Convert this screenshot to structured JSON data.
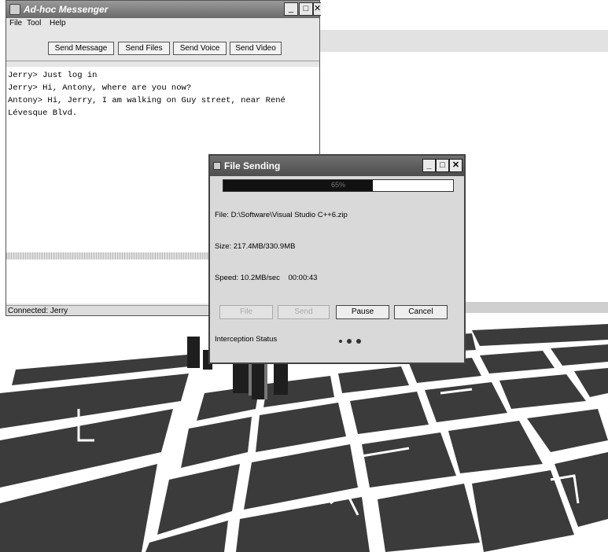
{
  "messenger": {
    "title": "Ad-hoc Messenger",
    "menu": [
      "File",
      "Tool",
      "Help"
    ],
    "toolbar": {
      "send_message": "Send Message",
      "send_files": "Send Files",
      "send_voice": "Send Voice",
      "send_video": "Send Video"
    },
    "chat_lines": [
      "Jerry> Just log in",
      "Jerry> Hi, Antony, where are you now?",
      "Antony> Hi, Jerry, I am walking on Guy street, near René",
      "Lévesque Blvd."
    ],
    "status": "Connected: Jerry"
  },
  "dialog": {
    "title": "File Sending",
    "progress_percent": 65,
    "progress_label": "65%",
    "file": "File: D:\\Software\\Visual Studio C++6.zip",
    "size": "Size: 217.4MB/330.9MB",
    "speed": "Speed: 10.2MB/sec    00:00:43",
    "buttons": {
      "file": "File",
      "send": "Send",
      "pause": "Pause",
      "cancel": "Cancel"
    },
    "interception_label": "Interception Status"
  },
  "colors": {
    "titlebar": "#6a6a6a",
    "dialog_bg": "#d9d9d9",
    "ground": "#3a3a3a",
    "road": "#ffffff"
  }
}
